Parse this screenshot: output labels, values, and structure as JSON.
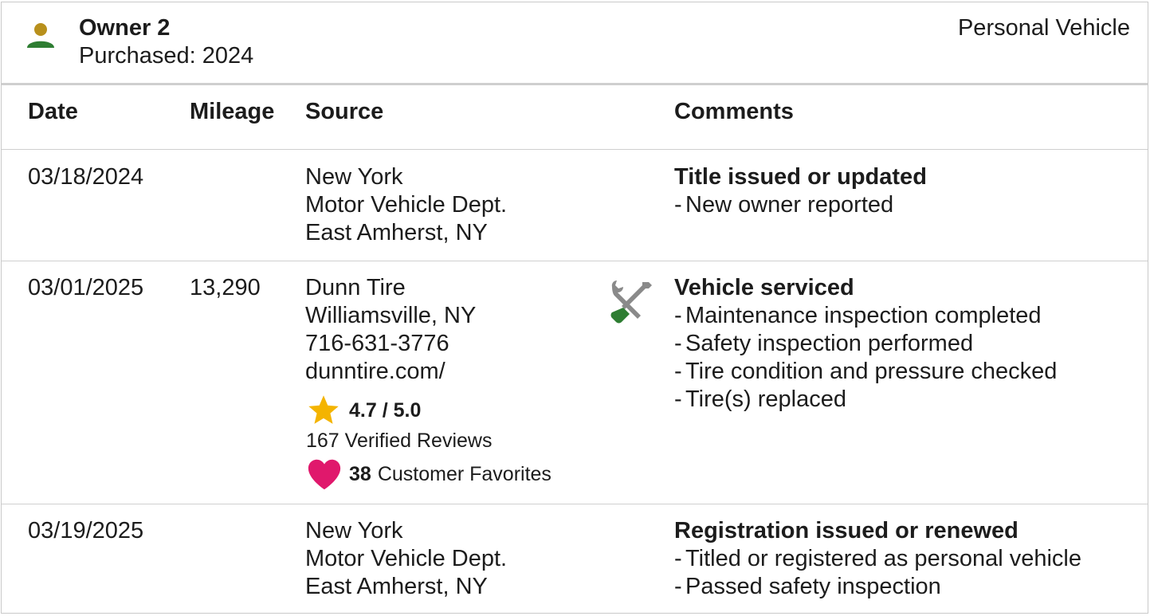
{
  "owner": {
    "title": "Owner 2",
    "purchased": "Purchased: 2024",
    "vehicle_type": "Personal Vehicle",
    "icon": "person-icon"
  },
  "columns": {
    "date": "Date",
    "mileage": "Mileage",
    "source": "Source",
    "comments": "Comments"
  },
  "records": [
    {
      "date": "03/18/2024",
      "mileage": "",
      "source": [
        "New York",
        "Motor Vehicle Dept.",
        "East Amherst, NY"
      ],
      "comment_title": "Title issued or updated",
      "comment_items": [
        "New owner reported"
      ]
    },
    {
      "date": "03/01/2025",
      "mileage": "13,290",
      "source": [
        "Dunn Tire",
        "Williamsville, NY",
        "716-631-3776",
        "dunntire.com/"
      ],
      "rating": "4.7 / 5.0",
      "reviews": "167 Verified Reviews",
      "favorites_count": "38",
      "favorites_label": "Customer Favorites",
      "icon": "wrench-screwdriver-icon",
      "comment_title": "Vehicle serviced",
      "comment_items": [
        "Maintenance inspection completed",
        "Safety inspection performed",
        "Tire condition and pressure checked",
        "Tire(s) replaced"
      ]
    },
    {
      "date": "03/19/2025",
      "mileage": "",
      "source": [
        "New York",
        "Motor Vehicle Dept.",
        "East Amherst, NY"
      ],
      "comment_title": "Registration issued or renewed",
      "comment_items": [
        "Titled or registered as personal vehicle",
        "Passed safety inspection"
      ]
    }
  ],
  "colors": {
    "person_head": "#b8901c",
    "person_body": "#2e7d32",
    "star": "#f4b400",
    "heart": "#e0186c",
    "tool_gray": "#8a8a8a",
    "tool_green": "#2e7d32"
  }
}
